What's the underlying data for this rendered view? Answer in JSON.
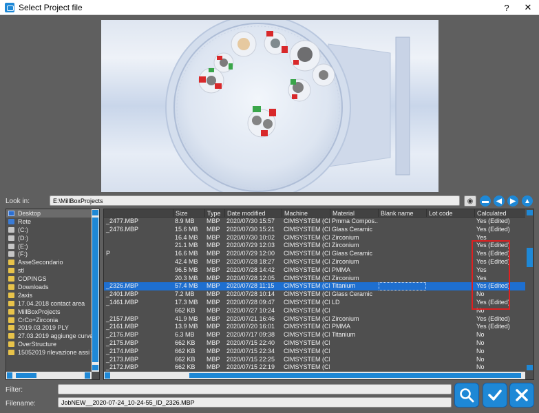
{
  "window": {
    "title": "Select Project file",
    "help_label": "?",
    "close_label": "✕"
  },
  "look_in": {
    "label": "Look in:",
    "value": "E:\\MillBoxProjects"
  },
  "folders": [
    {
      "label": "Desktop",
      "icon": "desktop"
    },
    {
      "label": "Rete",
      "icon": "net"
    },
    {
      "label": "(C:)",
      "icon": "drive"
    },
    {
      "label": "(D:)",
      "icon": "drive"
    },
    {
      "label": "(E:)",
      "icon": "drive"
    },
    {
      "label": "(F:)",
      "icon": "drive"
    },
    {
      "label": "AsseSecondario",
      "icon": "folder"
    },
    {
      "label": "stl",
      "icon": "folder"
    },
    {
      "label": "COPINGS",
      "icon": "folder"
    },
    {
      "label": "Downloads",
      "icon": "folder"
    },
    {
      "label": "2axis",
      "icon": "folder"
    },
    {
      "label": "17.04.2018 contact area",
      "icon": "folder"
    },
    {
      "label": "MillBoxProjects",
      "icon": "folder"
    },
    {
      "label": "CrCo+Zirconia",
      "icon": "folder"
    },
    {
      "label": "2019.03.2019 PLY",
      "icon": "folder"
    },
    {
      "label": "27.03.2019 aggiunge curve su",
      "icon": "folder"
    },
    {
      "label": "OverStructure",
      "icon": "folder"
    },
    {
      "label": "15052019 rilevazione assi fatt",
      "icon": "folder"
    }
  ],
  "columns": [
    "Size",
    "Type",
    "Date modified",
    "Machine",
    "Material",
    "Blank name",
    "Lot code",
    "Calculated"
  ],
  "files": [
    {
      "name": "_2477.MBP",
      "size": "8.9 MB",
      "type": "MBP",
      "date": "2020/07/30 15:57",
      "machine": "CIMSYSTEM (CI...",
      "material": "Pmma Compos...",
      "calculated": "Yes (Edited)"
    },
    {
      "name": "_2476.MBP",
      "size": "15.6 MB",
      "type": "MBP",
      "date": "2020/07/30 15:21",
      "machine": "CIMSYSTEM (CI...",
      "material": "Glass Ceramic",
      "calculated": "Yes (Edited)"
    },
    {
      "name": "",
      "size": "16.4 MB",
      "type": "MBP",
      "date": "2020/07/30 10:02",
      "machine": "CIMSYSTEM (CI...",
      "material": "Zirconium",
      "calculated": "Yes"
    },
    {
      "name": "",
      "size": "21.1 MB",
      "type": "MBP",
      "date": "2020/07/29 12:03",
      "machine": "CIMSYSTEM (CI...",
      "material": "Zirconium",
      "calculated": "Yes (Edited)"
    },
    {
      "name": "P",
      "size": "16.6 MB",
      "type": "MBP",
      "date": "2020/07/29 12:00",
      "machine": "CIMSYSTEM (CI...",
      "material": "Glass Ceramic",
      "calculated": "Yes (Edited)"
    },
    {
      "name": "",
      "size": "42.4 MB",
      "type": "MBP",
      "date": "2020/07/28 18:27",
      "machine": "CIMSYSTEM (CI...",
      "material": "Zirconium",
      "calculated": "Yes (Edited)"
    },
    {
      "name": "",
      "size": "96.5 MB",
      "type": "MBP",
      "date": "2020/07/28 14:42",
      "machine": "CIMSYSTEM (CI...",
      "material": "PMMA",
      "calculated": "Yes"
    },
    {
      "name": "",
      "size": "20.3 MB",
      "type": "MBP",
      "date": "2020/07/28 12:05",
      "machine": "CIMSYSTEM (CI...",
      "material": "Zirconium",
      "calculated": "Yes"
    },
    {
      "name": "_2326.MBP",
      "size": "57.4 MB",
      "type": "MBP",
      "date": "2020/07/28 11:15",
      "machine": "CIMSYSTEM (CI...",
      "material": "Titanium",
      "calculated": "Yes (Edited)",
      "selected": true
    },
    {
      "name": "_2401.MBP",
      "size": "7.2 MB",
      "type": "MBP",
      "date": "2020/07/28 10:14",
      "machine": "CIMSYSTEM (CI...",
      "material": "Glass Ceramic",
      "calculated": "No"
    },
    {
      "name": "_1461.MBP",
      "size": "17.3 MB",
      "type": "MBP",
      "date": "2020/07/28 09:47",
      "machine": "CIMSYSTEM (CI...",
      "material": "LD",
      "calculated": "Yes (Edited)"
    },
    {
      "name": "",
      "size": "662 KB",
      "type": "MBP",
      "date": "2020/07/27 10:24",
      "machine": "CIMSYSTEM (CI...",
      "material": "",
      "calculated": "No"
    },
    {
      "name": "_2157.MBP",
      "size": "41.9 MB",
      "type": "MBP",
      "date": "2020/07/21 16:46",
      "machine": "CIMSYSTEM (CI...",
      "material": "Zirconium",
      "calculated": "Yes (Edited)"
    },
    {
      "name": "_2161.MBP",
      "size": "13.9 MB",
      "type": "MBP",
      "date": "2020/07/20 16:01",
      "machine": "CIMSYSTEM (CI...",
      "material": "PMMA",
      "calculated": "Yes (Edited)"
    },
    {
      "name": "_2176.MBP",
      "size": "6.3 MB",
      "type": "MBP",
      "date": "2020/07/17 09:38",
      "machine": "CIMSYSTEM (CI...",
      "material": "Titanium",
      "calculated": "No"
    },
    {
      "name": "_2175.MBP",
      "size": "662 KB",
      "type": "MBP",
      "date": "2020/07/15 22:40",
      "machine": "CIMSYSTEM (CI...",
      "material": "",
      "calculated": "No"
    },
    {
      "name": "_2174.MBP",
      "size": "662 KB",
      "type": "MBP",
      "date": "2020/07/15 22:34",
      "machine": "CIMSYSTEM (CI...",
      "material": "",
      "calculated": "No"
    },
    {
      "name": "_2173.MBP",
      "size": "662 KB",
      "type": "MBP",
      "date": "2020/07/15 22:25",
      "machine": "CIMSYSTEM (CI...",
      "material": "",
      "calculated": "No"
    },
    {
      "name": "_2172.MBP",
      "size": "662 KB",
      "type": "MBP",
      "date": "2020/07/15 22:19",
      "machine": "CIMSYSTEM (CI...",
      "material": "",
      "calculated": "No"
    }
  ],
  "filter": {
    "label": "Filter:",
    "value": ""
  },
  "filename": {
    "label": "Filename:",
    "value": "JobNEW__2020-07-24_10-24-55_ID_2326.MBP"
  },
  "colors": {
    "accent": "#1e88d6",
    "selection": "#1e6fd0",
    "highlight": "#e02020"
  }
}
